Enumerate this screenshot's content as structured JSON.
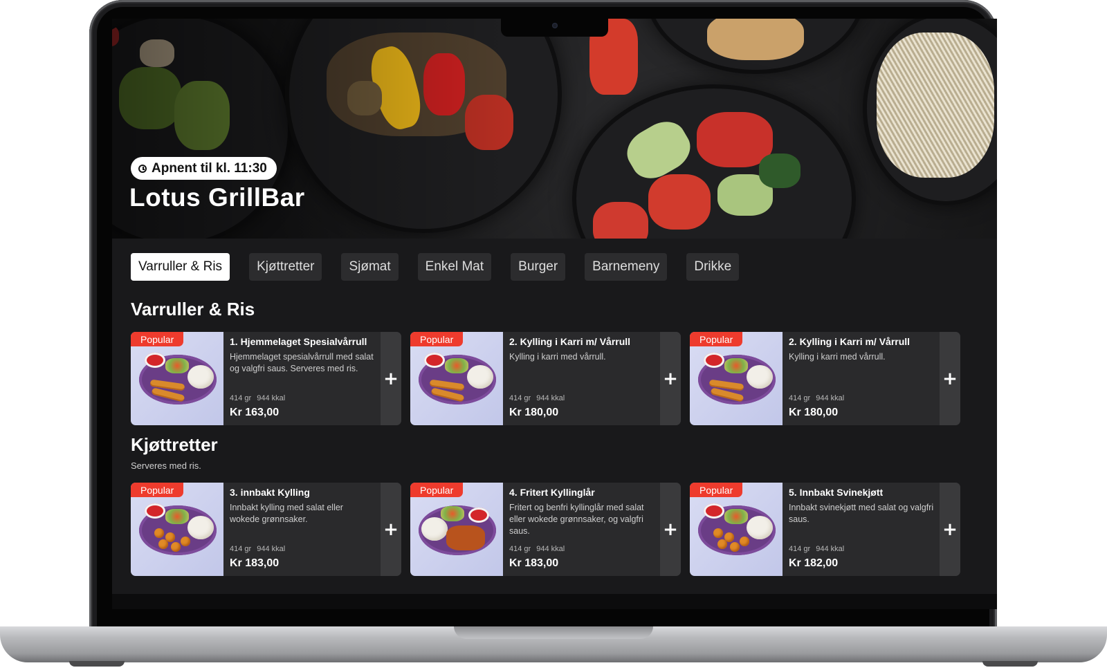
{
  "restaurant": {
    "name": "Lotus GrillBar",
    "open_status": "Apnent til kl. 11:30"
  },
  "tabs": [
    {
      "label": "Varruller & Ris",
      "active": true
    },
    {
      "label": "Kjøttretter",
      "active": false
    },
    {
      "label": "Sjømat",
      "active": false
    },
    {
      "label": "Enkel Mat",
      "active": false
    },
    {
      "label": "Burger",
      "active": false
    },
    {
      "label": "Barnemeny",
      "active": false
    },
    {
      "label": "Drikke",
      "active": false
    }
  ],
  "sections": [
    {
      "title": "Varruller & Ris",
      "subtitle": "",
      "items": [
        {
          "badge": "Popular",
          "name": "1. Hjemmelaget Spesialvårrull",
          "description": "Hjemmelaget spesialvårrull med salat og valgfri saus. Serveres med ris.",
          "weight": "414 gr",
          "kcal": "944 kkal",
          "price": "Kr 163,00",
          "add": "+"
        },
        {
          "badge": "Popular",
          "name": "2. Kylling i Karri m/ Vårrull",
          "description": "Kylling i karri med vårrull.",
          "weight": "414 gr",
          "kcal": "944 kkal",
          "price": "Kr 180,00",
          "add": "+"
        },
        {
          "badge": "Popular",
          "name": "2. Kylling i Karri m/ Vårrull",
          "description": "Kylling i karri med vårrull.",
          "weight": "414 gr",
          "kcal": "944 kkal",
          "price": "Kr 180,00",
          "add": "+"
        }
      ]
    },
    {
      "title": "Kjøttretter",
      "subtitle": "Serveres med ris.",
      "items": [
        {
          "badge": "Popular",
          "name": "3. innbakt Kylling",
          "description": "Innbakt kylling med salat eller wokede grønnsaker.",
          "weight": "414 gr",
          "kcal": "944 kkal",
          "price": "Kr 183,00",
          "add": "+"
        },
        {
          "badge": "Popular",
          "name": "4. Fritert Kyllinglår",
          "description": "Fritert og benfri kyllinglår med salat eller wokede grønnsaker, og valgfri saus.",
          "weight": "414 gr",
          "kcal": "944 kkal",
          "price": "Kr 183,00",
          "add": "+"
        },
        {
          "badge": "Popular",
          "name": "5. Innbakt Svinekjøtt",
          "description": "Innbakt svinekjøtt med salat og valgfri saus.",
          "weight": "414 gr",
          "kcal": "944 kkal",
          "price": "Kr 182,00",
          "add": "+"
        }
      ]
    }
  ],
  "colors": {
    "accent_badge": "#ee3b2d",
    "screen_bg": "#19191b",
    "card_bg": "#2a2a2c",
    "tab_bg": "#2c2c2e",
    "tab_active_bg": "#ffffff",
    "plate": "#6a3d86"
  },
  "icons": {
    "open_status": "clock-icon",
    "add": "plus-icon"
  }
}
